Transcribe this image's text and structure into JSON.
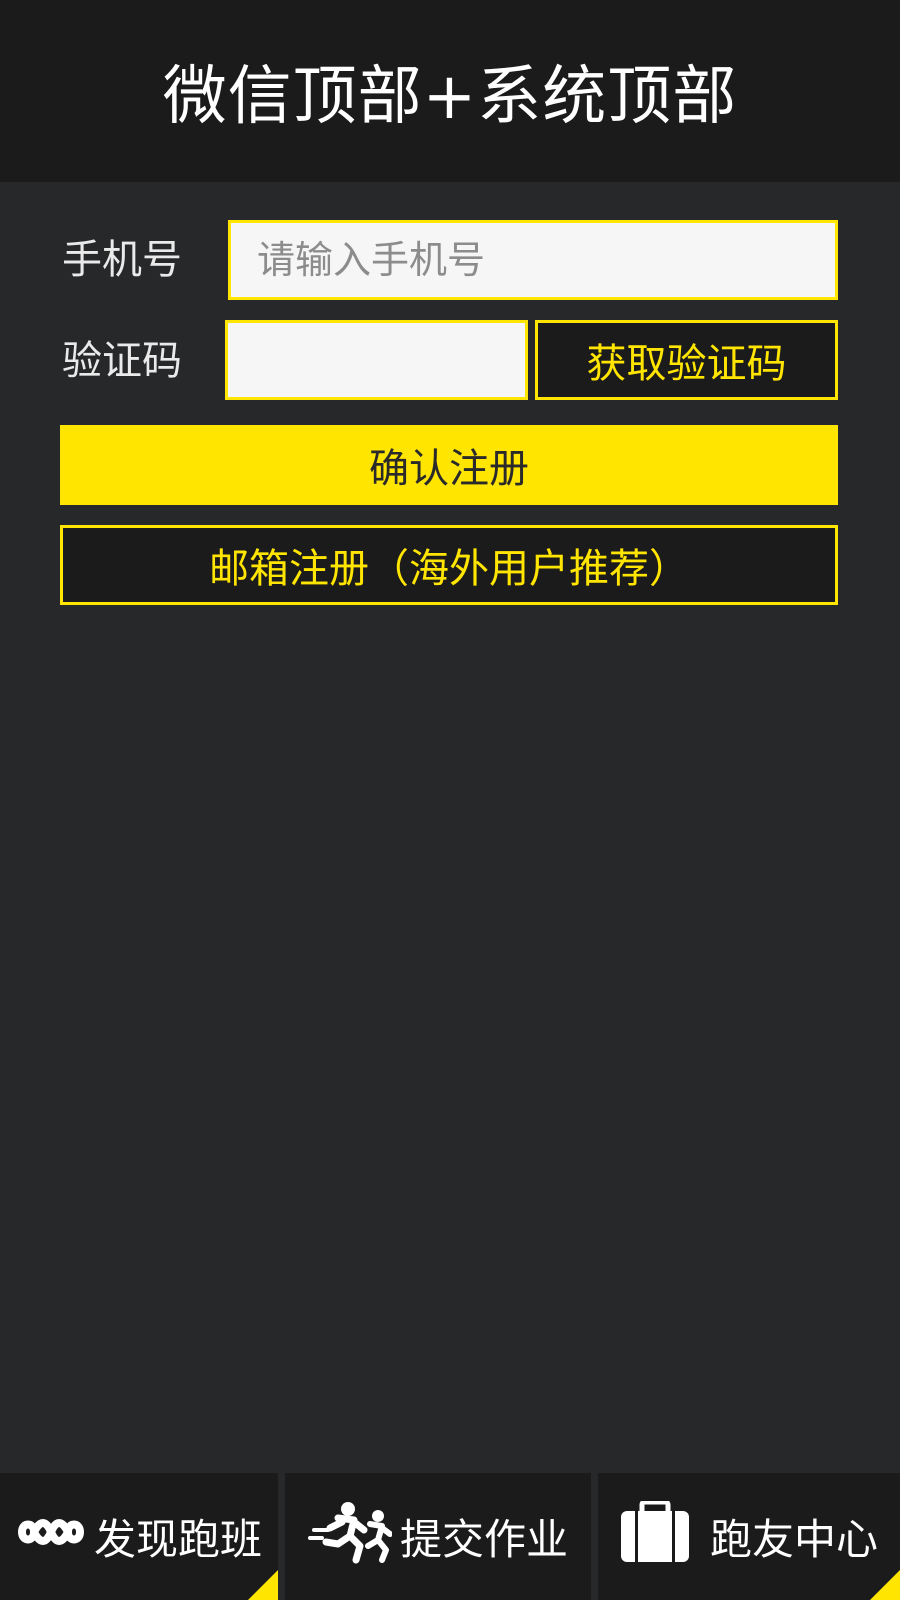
{
  "header": {
    "title": "微信顶部+系统顶部"
  },
  "form": {
    "phone_label": "手机号",
    "phone_placeholder": "请输入手机号",
    "code_label": "验证码",
    "code_value": "",
    "get_code_label": "获取验证码",
    "confirm_label": "确认注册",
    "email_register_label": "邮箱注册（海外用户推荐）"
  },
  "tabbar": {
    "tabs": [
      {
        "label": "发现跑班",
        "icon": "infinity-icon",
        "selected": true
      },
      {
        "label": "提交作业",
        "icon": "running-people-icon",
        "selected": false
      },
      {
        "label": "跑友中心",
        "icon": "briefcase-icon",
        "selected": true
      }
    ]
  },
  "colors": {
    "accent": "#ffe500",
    "background": "#27282a",
    "header_background": "#1b1b1b",
    "input_background": "#f6f6f6"
  }
}
